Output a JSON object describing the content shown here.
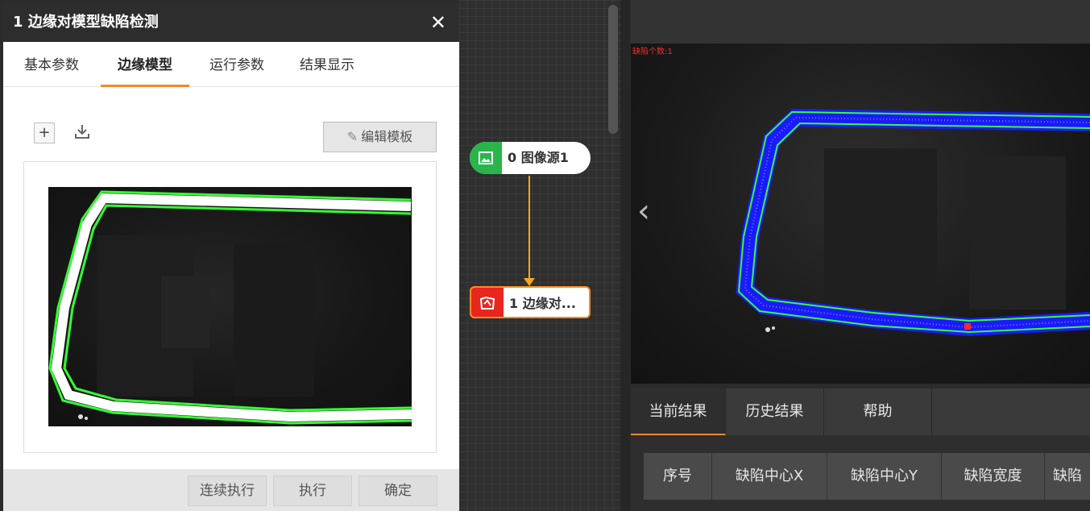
{
  "dialog": {
    "title": "1 边缘对模型缺陷检测",
    "close": "✕",
    "tabs": [
      "基本参数",
      "边缘模型",
      "运行参数",
      "结果显示"
    ],
    "active_tab": 1,
    "edit_template_label": "编辑模板",
    "footer": {
      "continuous_label": "连续执行",
      "execute_label": "执行",
      "confirm_label": "确定"
    }
  },
  "flow": {
    "nodes": [
      {
        "label": "0 图像源1",
        "icon": "image-icon"
      },
      {
        "label": "1 边缘对...",
        "icon": "edge-model-icon"
      }
    ]
  },
  "viewer": {
    "defect_count_text": "缺陷个数:1",
    "prev_glyph": "‹"
  },
  "results": {
    "tabs": [
      "当前结果",
      "历史结果",
      "帮助"
    ],
    "active_tab": 0,
    "columns": [
      "序号",
      "缺陷中心X",
      "缺陷中心Y",
      "缺陷宽度",
      "缺陷"
    ]
  },
  "colors": {
    "accent": "#f5891f",
    "contour_green": "#35ff35",
    "contour_blue": "#1a1aff",
    "node_source": "#2ab54a",
    "node_selected": "#e8261e",
    "defect_red": "#ff2a2a"
  }
}
